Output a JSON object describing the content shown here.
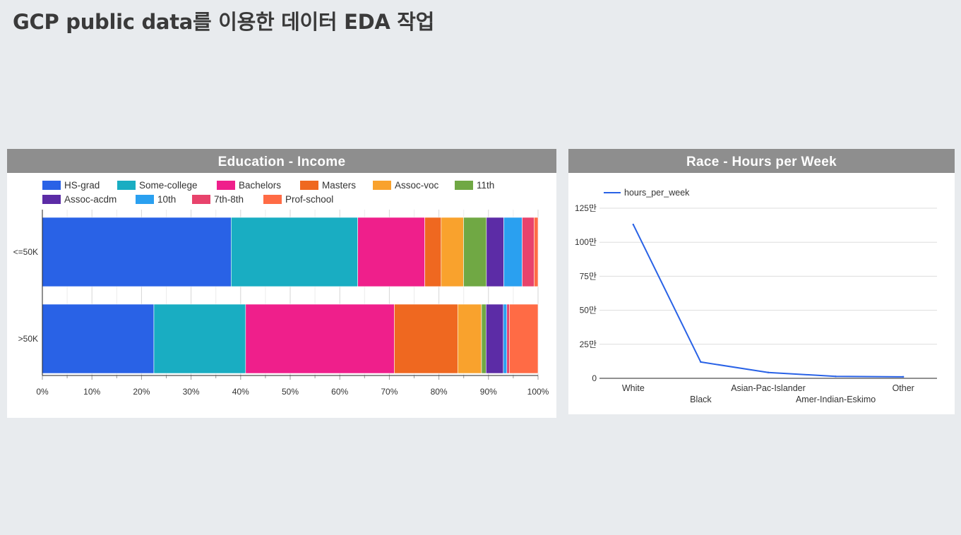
{
  "page": {
    "title": "GCP public data를 이용한 데이터 EDA 작업"
  },
  "panels": {
    "education": {
      "title": "Education - Income"
    },
    "race": {
      "title": "Race - Hours per Week"
    }
  },
  "chart_data": [
    {
      "type": "bar",
      "orientation": "horizontal",
      "stacked": "percent",
      "title": "Education - Income",
      "categories": [
        "<=50K",
        ">50K"
      ],
      "series": [
        {
          "name": "HS-grad",
          "color": "#2962e6",
          "values": [
            38.0,
            22.5
          ]
        },
        {
          "name": "Some-college",
          "color": "#19adc2",
          "values": [
            25.5,
            18.5
          ]
        },
        {
          "name": "Bachelors",
          "color": "#ef1f8b",
          "values": [
            13.5,
            30.0
          ]
        },
        {
          "name": "Masters",
          "color": "#ef6820",
          "values": [
            3.3,
            12.8
          ]
        },
        {
          "name": "Assoc-voc",
          "color": "#f9a22d",
          "values": [
            4.5,
            4.8
          ]
        },
        {
          "name": "11th",
          "color": "#70a844",
          "values": [
            4.6,
            0.9
          ]
        },
        {
          "name": "Assoc-acdm",
          "color": "#5c2ca6",
          "values": [
            3.5,
            3.5
          ]
        },
        {
          "name": "10th",
          "color": "#2aa0f0",
          "values": [
            3.7,
            0.7
          ]
        },
        {
          "name": "7th-8th",
          "color": "#e8436c",
          "values": [
            2.4,
            0.5
          ]
        },
        {
          "name": "Prof-school",
          "color": "#ff6b45",
          "values": [
            0.8,
            5.8
          ]
        }
      ],
      "xlim": [
        0,
        100
      ],
      "xticks": [
        "0%",
        "10%",
        "20%",
        "30%",
        "40%",
        "50%",
        "60%",
        "70%",
        "80%",
        "90%",
        "100%"
      ],
      "legend": "top",
      "grid": true
    },
    {
      "type": "line",
      "title": "Race - Hours per Week",
      "categories": [
        "White",
        "Black",
        "Asian-Pac-Islander",
        "Amer-Indian-Eskimo",
        "Other"
      ],
      "series": [
        {
          "name": "hours_per_week",
          "color": "#2962e6",
          "values": [
            1130000,
            120000,
            43000,
            14000,
            11000
          ]
        }
      ],
      "ylim": [
        0,
        1250000
      ],
      "yticks": [
        {
          "value": 0,
          "label": "0"
        },
        {
          "value": 250000,
          "label": "25만"
        },
        {
          "value": 500000,
          "label": "50만"
        },
        {
          "value": 750000,
          "label": "75만"
        },
        {
          "value": 1000000,
          "label": "100만"
        },
        {
          "value": 1250000,
          "label": "125만"
        }
      ],
      "legend": "top-left",
      "grid": true
    }
  ]
}
